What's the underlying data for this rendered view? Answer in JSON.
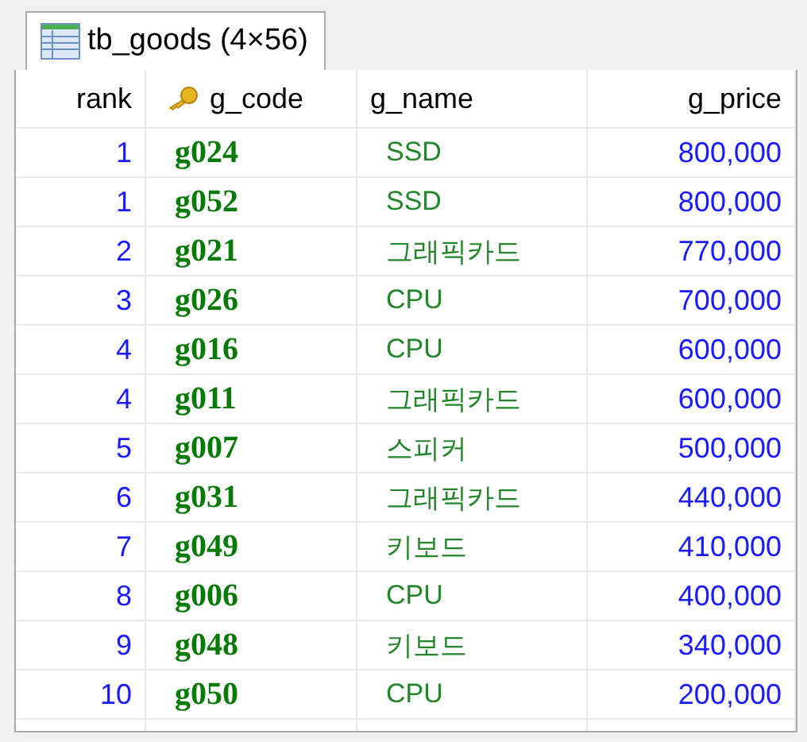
{
  "tab": {
    "title": "tb_goods (4×56)",
    "selected": true
  },
  "table": {
    "columns": [
      {
        "label": "rank",
        "key_icon": false
      },
      {
        "label": "g_code",
        "key_icon": true
      },
      {
        "label": "g_name",
        "key_icon": false
      },
      {
        "label": "g_price",
        "key_icon": false
      }
    ],
    "rows": [
      {
        "rank": "1",
        "g_code": "g024",
        "g_name": "SSD",
        "g_price": "800,000"
      },
      {
        "rank": "1",
        "g_code": "g052",
        "g_name": "SSD",
        "g_price": "800,000"
      },
      {
        "rank": "2",
        "g_code": "g021",
        "g_name": "그래픽카드",
        "g_price": "770,000"
      },
      {
        "rank": "3",
        "g_code": "g026",
        "g_name": "CPU",
        "g_price": "700,000"
      },
      {
        "rank": "4",
        "g_code": "g016",
        "g_name": "CPU",
        "g_price": "600,000"
      },
      {
        "rank": "4",
        "g_code": "g011",
        "g_name": "그래픽카드",
        "g_price": "600,000"
      },
      {
        "rank": "5",
        "g_code": "g007",
        "g_name": "스피커",
        "g_price": "500,000"
      },
      {
        "rank": "6",
        "g_code": "g031",
        "g_name": "그래픽카드",
        "g_price": "440,000"
      },
      {
        "rank": "7",
        "g_code": "g049",
        "g_name": "키보드",
        "g_price": "410,000"
      },
      {
        "rank": "8",
        "g_code": "g006",
        "g_name": "CPU",
        "g_price": "400,000"
      },
      {
        "rank": "9",
        "g_code": "g048",
        "g_name": "키보드",
        "g_price": "340,000"
      },
      {
        "rank": "10",
        "g_code": "g050",
        "g_name": "CPU",
        "g_price": "200,000"
      }
    ]
  }
}
